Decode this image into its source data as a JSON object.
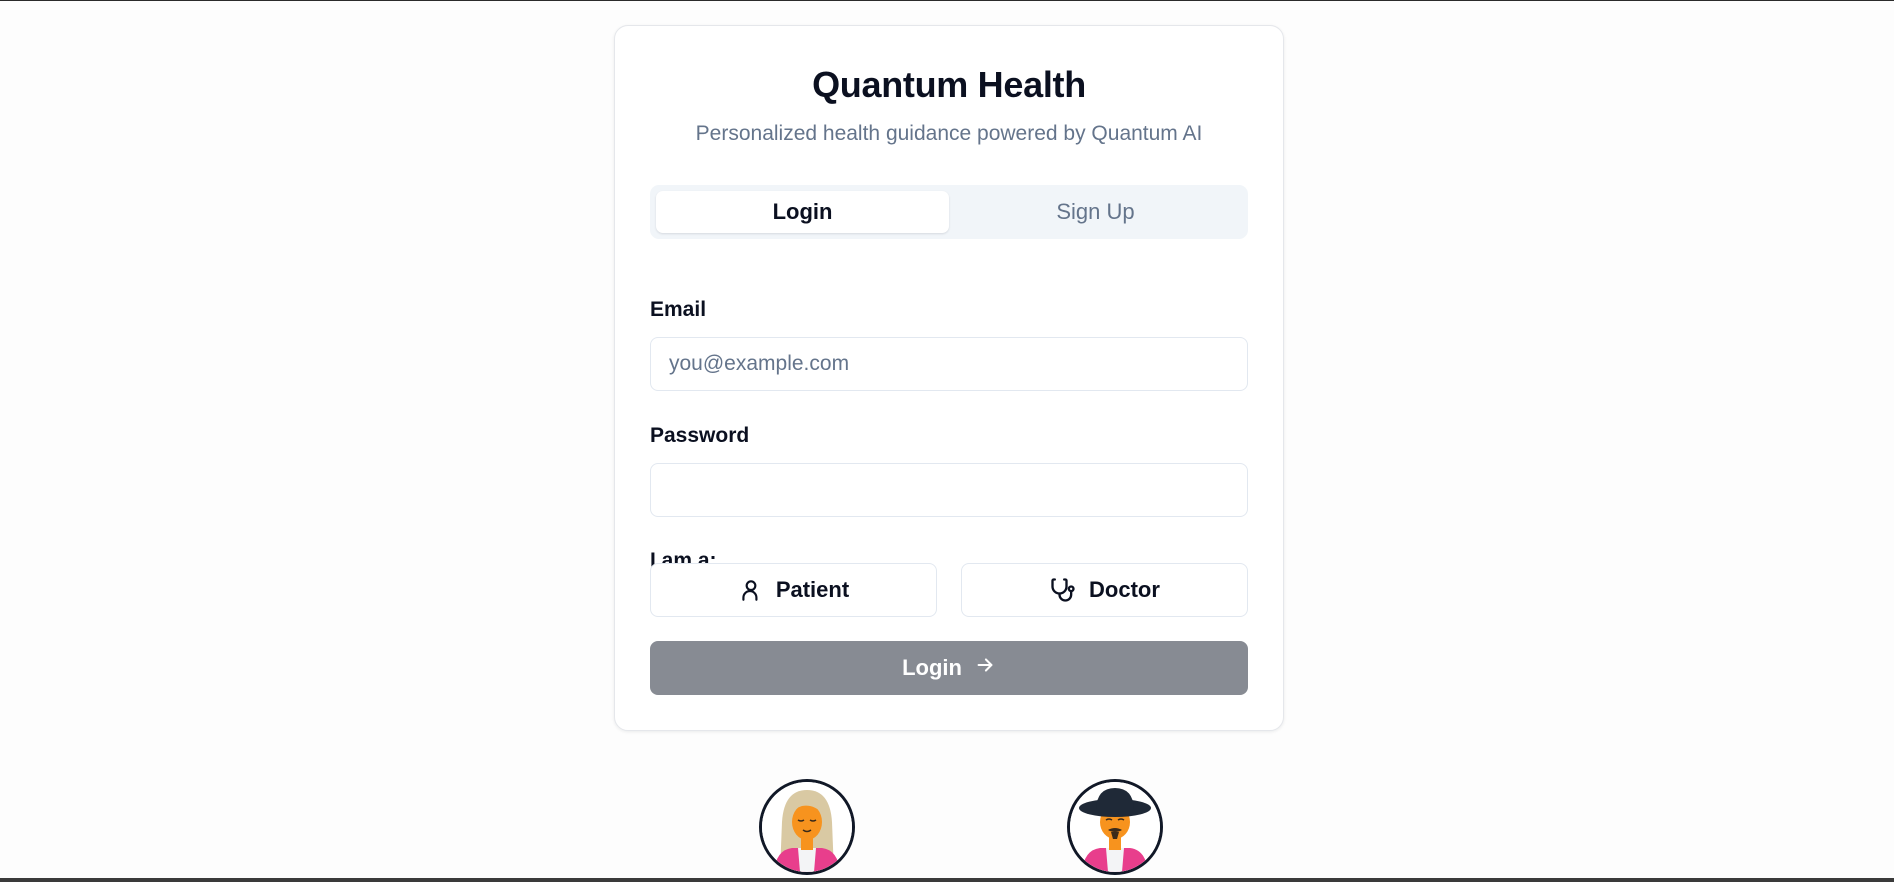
{
  "app": {
    "title": "Quantum Health",
    "subtitle": "Personalized health guidance powered by Quantum AI"
  },
  "tabs": [
    {
      "label": "Login",
      "active": true
    },
    {
      "label": "Sign Up",
      "active": false
    }
  ],
  "form": {
    "email_label": "Email",
    "email_value": "",
    "email_placeholder": "you@example.com",
    "password_label": "Password",
    "password_value": "",
    "role_label": "I am a:",
    "roles": [
      {
        "label": "Patient",
        "icon": "user-icon"
      },
      {
        "label": "Doctor",
        "icon": "stethoscope-icon"
      }
    ],
    "submit_label": "Login",
    "submit_icon": "arrow-right-icon"
  },
  "avatars": [
    {
      "icon": "female-patient-avatar"
    },
    {
      "icon": "male-doctor-avatar"
    }
  ],
  "colors": {
    "submit_disabled": "#878b93",
    "tab_track": "#f1f5f9",
    "muted_text": "#64748b",
    "avatar_skin": "#f7931e",
    "avatar_jacket": "#e83e8c"
  }
}
